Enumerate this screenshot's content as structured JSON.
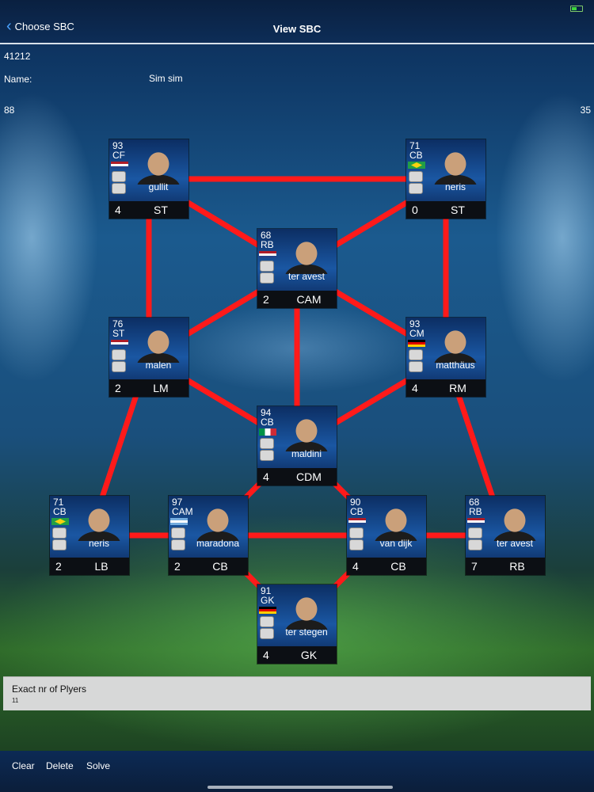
{
  "nav": {
    "back_label": "Choose SBC",
    "title": "View SBC"
  },
  "sbc": {
    "formation": "41212",
    "name_label": "Name:",
    "name_value": "Sim sim",
    "stat_left": "88",
    "stat_right": "35"
  },
  "cards": [
    {
      "id": "st-left",
      "rating": "93",
      "pos": "CF",
      "flag": "nl",
      "name": "gullit",
      "count": "4",
      "slot": "ST"
    },
    {
      "id": "st-right",
      "rating": "71",
      "pos": "CB",
      "flag": "br",
      "name": "neris",
      "count": "0",
      "slot": "ST"
    },
    {
      "id": "cam",
      "rating": "68",
      "pos": "RB",
      "flag": "nl",
      "name": "ter avest",
      "count": "2",
      "slot": "CAM"
    },
    {
      "id": "lm",
      "rating": "76",
      "pos": "ST",
      "flag": "nl",
      "name": "malen",
      "count": "2",
      "slot": "LM"
    },
    {
      "id": "rm",
      "rating": "93",
      "pos": "CM",
      "flag": "de",
      "name": "matthäus",
      "count": "4",
      "slot": "RM"
    },
    {
      "id": "cdm",
      "rating": "94",
      "pos": "CB",
      "flag": "it",
      "name": "maldini",
      "count": "4",
      "slot": "CDM"
    },
    {
      "id": "lb",
      "rating": "71",
      "pos": "CB",
      "flag": "br",
      "name": "neris",
      "count": "2",
      "slot": "LB"
    },
    {
      "id": "lcb",
      "rating": "97",
      "pos": "CAM",
      "flag": "ar",
      "name": "maradona",
      "count": "2",
      "slot": "CB"
    },
    {
      "id": "rcb",
      "rating": "90",
      "pos": "CB",
      "flag": "nl",
      "name": "van dijk",
      "count": "4",
      "slot": "CB"
    },
    {
      "id": "rb",
      "rating": "68",
      "pos": "RB",
      "flag": "nl",
      "name": "ter avest",
      "count": "7",
      "slot": "RB"
    },
    {
      "id": "gk",
      "rating": "91",
      "pos": "GK",
      "flag": "de",
      "name": "ter stegen",
      "count": "4",
      "slot": "GK"
    }
  ],
  "links": [
    [
      "st-left",
      "st-right"
    ],
    [
      "st-left",
      "cam"
    ],
    [
      "st-right",
      "cam"
    ],
    [
      "st-left",
      "lm"
    ],
    [
      "st-right",
      "rm"
    ],
    [
      "cam",
      "lm"
    ],
    [
      "cam",
      "rm"
    ],
    [
      "cam",
      "cdm"
    ],
    [
      "lm",
      "cdm"
    ],
    [
      "rm",
      "cdm"
    ],
    [
      "lm",
      "lb"
    ],
    [
      "rm",
      "rb"
    ],
    [
      "cdm",
      "lcb"
    ],
    [
      "cdm",
      "rcb"
    ],
    [
      "lb",
      "lcb"
    ],
    [
      "lcb",
      "rcb"
    ],
    [
      "rcb",
      "rb"
    ],
    [
      "lcb",
      "gk"
    ],
    [
      "rcb",
      "gk"
    ]
  ],
  "requirement": {
    "title": "Exact nr of Plyers",
    "value": "11"
  },
  "footer": {
    "clear": "Clear",
    "delete": "Delete",
    "solve": "Solve"
  },
  "colors": {
    "link": "#ff1a1a",
    "accent": "#4aa3ff"
  }
}
